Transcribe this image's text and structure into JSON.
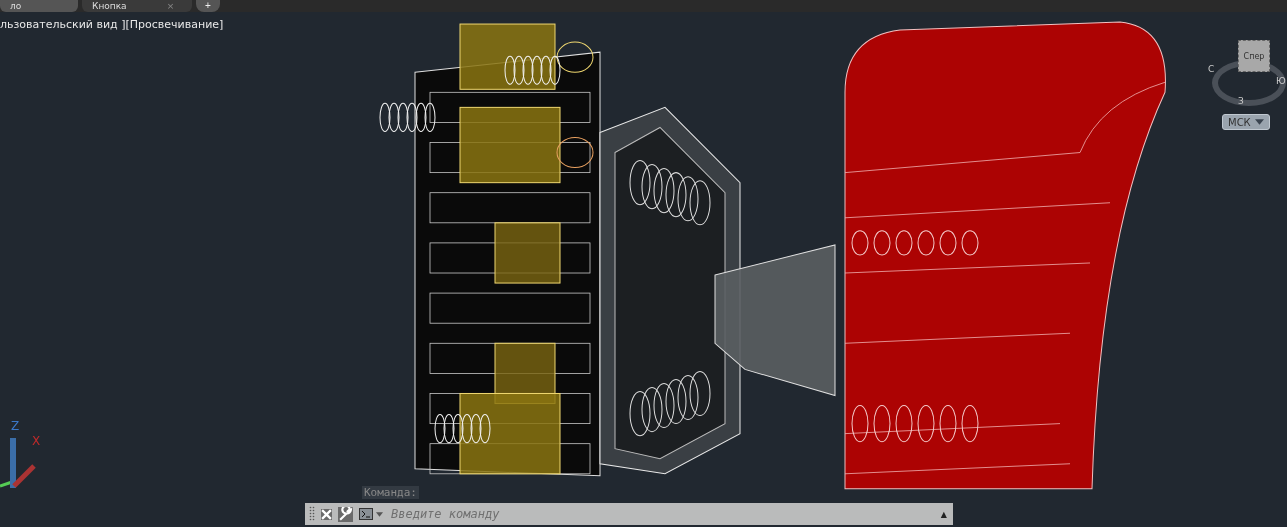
{
  "tabs": [
    {
      "label": "ло",
      "selected": false
    },
    {
      "label": "Кнопка",
      "selected": true,
      "close": "×"
    }
  ],
  "new_tab": "+",
  "viewport_label": "льзовательский вид ][Просвечивание]",
  "viewcube": {
    "face": "Спер",
    "compass": [
      "С",
      "Ю",
      "З"
    ]
  },
  "ucs_menu": "МСК",
  "axes": {
    "z": "Z",
    "x": "X"
  },
  "command_history": "Команда:",
  "command_line": {
    "placeholder": "Введите команду",
    "history_arrow": "▲"
  }
}
